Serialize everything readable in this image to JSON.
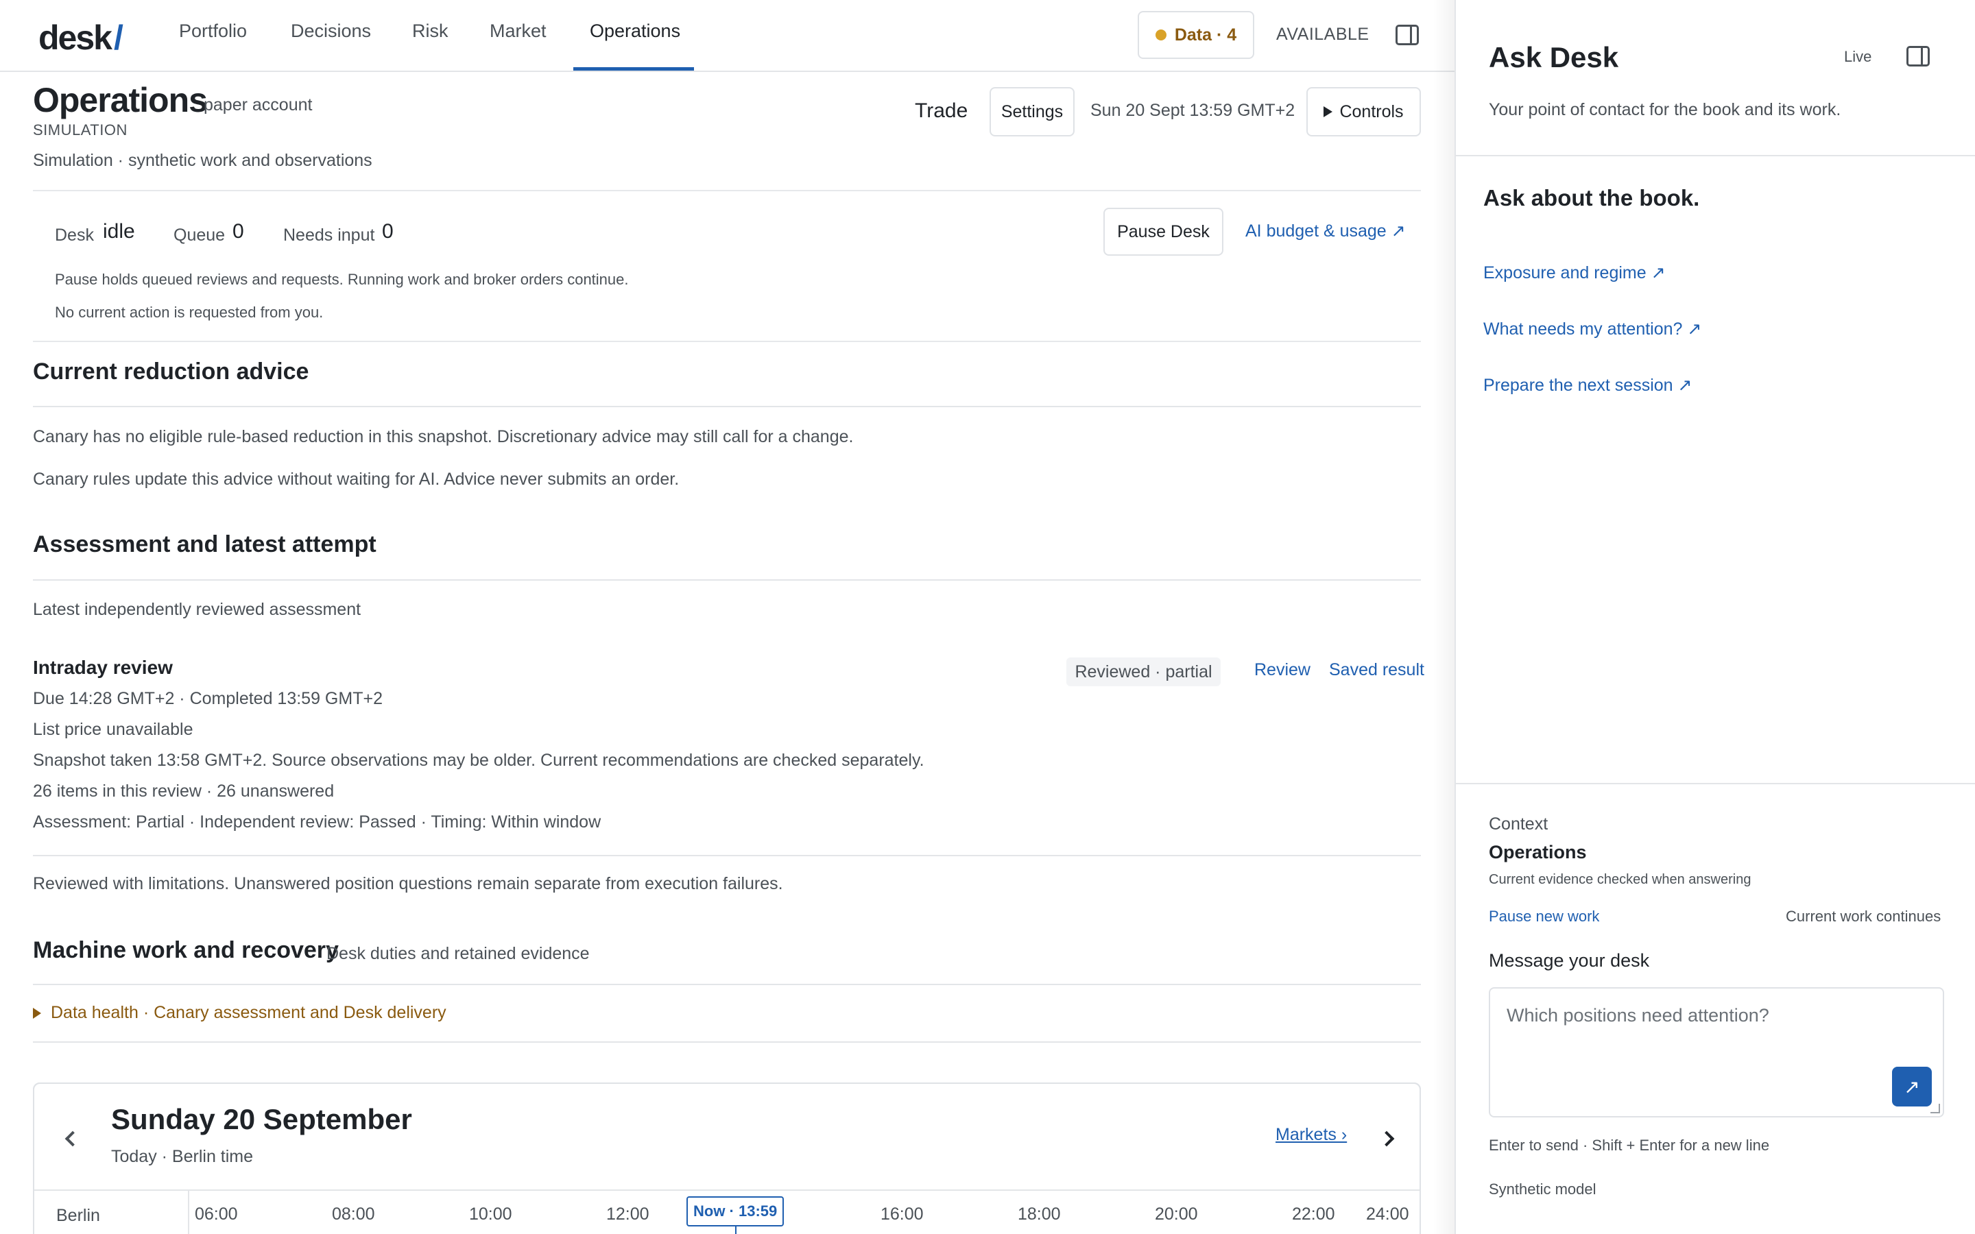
{
  "brand": {
    "logo_text": "desk",
    "logo_slash": "/"
  },
  "nav": {
    "tabs": [
      "Portfolio",
      "Decisions",
      "Risk",
      "Market",
      "Operations"
    ],
    "active_tab": "Operations",
    "data_pill": "Data · 4",
    "availability": "AVAILABLE"
  },
  "header": {
    "title": "Operations",
    "account": "paper account",
    "mode": "SIMULATION",
    "subtitle": "Simulation · synthetic work and observations",
    "trade_label": "Trade",
    "settings_label": "Settings",
    "datetime": "Sun 20 Sept 13:59 GMT+2",
    "controls_label": "Controls"
  },
  "desk_status": {
    "desk_label": "Desk",
    "desk_value": "idle",
    "queue_label": "Queue",
    "queue_value": "0",
    "needs_input_label": "Needs input",
    "needs_input_value": "0",
    "pause_button": "Pause Desk",
    "budget_link": "AI budget & usage ↗",
    "note_1": "Pause holds queued reviews and requests. Running work and broker orders continue.",
    "note_2": "No current action is requested from you."
  },
  "reduction": {
    "heading": "Current reduction advice",
    "line_1": "Canary has no eligible rule-based reduction in this snapshot. Discretionary advice may still call for a change.",
    "line_2": "Canary rules update this advice without waiting for AI. Advice never submits an order."
  },
  "assessment": {
    "heading": "Assessment and latest attempt",
    "subheading": "Latest independently reviewed assessment",
    "review_title": "Intraday review",
    "badge": "Reviewed · partial",
    "review_link": "Review",
    "saved_link": "Saved result",
    "lines": [
      "Due 14:28 GMT+2 · Completed 13:59 GMT+2",
      "List price unavailable",
      "Snapshot taken 13:58 GMT+2. Source observations may be older. Current recommendations are checked separately.",
      "26 items in this review · 26 unanswered",
      "Assessment: Partial · Independent review: Passed · Timing: Within window"
    ],
    "footnote": "Reviewed with limitations. Unanswered position questions remain separate from execution failures."
  },
  "machine": {
    "heading": "Machine work and recovery",
    "subheading": "Desk duties and retained evidence",
    "details_summary": "Data health · Canary assessment and Desk delivery"
  },
  "calendar": {
    "date_title": "Sunday 20 September",
    "date_sub": "Today · Berlin time",
    "markets_link": "Markets ›",
    "row_label": "Berlin",
    "hours": [
      "06:00",
      "08:00",
      "10:00",
      "12:00",
      "16:00",
      "18:00",
      "20:00",
      "22:00",
      "24:00"
    ],
    "now_label": "Now · 13:59"
  },
  "side": {
    "title": "Ask Desk",
    "live_label": "Live",
    "description": "Your point of contact for the book and its work.",
    "prompt_heading": "Ask about the book.",
    "prompts": [
      "Exposure and regime ↗",
      "What needs my attention? ↗",
      "Prepare the next session ↗"
    ],
    "context_label": "Context",
    "context_value": "Operations",
    "context_note": "Current evidence checked when answering",
    "pause_link": "Pause new work",
    "work_status": "Current work continues",
    "message_label": "Message your desk",
    "message_placeholder": "Which positions need attention?",
    "send_icon": "↗",
    "hint": "Enter to send · Shift + Enter for a new line",
    "model": "Synthetic model"
  },
  "colors": {
    "accent": "#1f5fb0",
    "warning": "#8a5a10",
    "dot": "#d9a228"
  }
}
